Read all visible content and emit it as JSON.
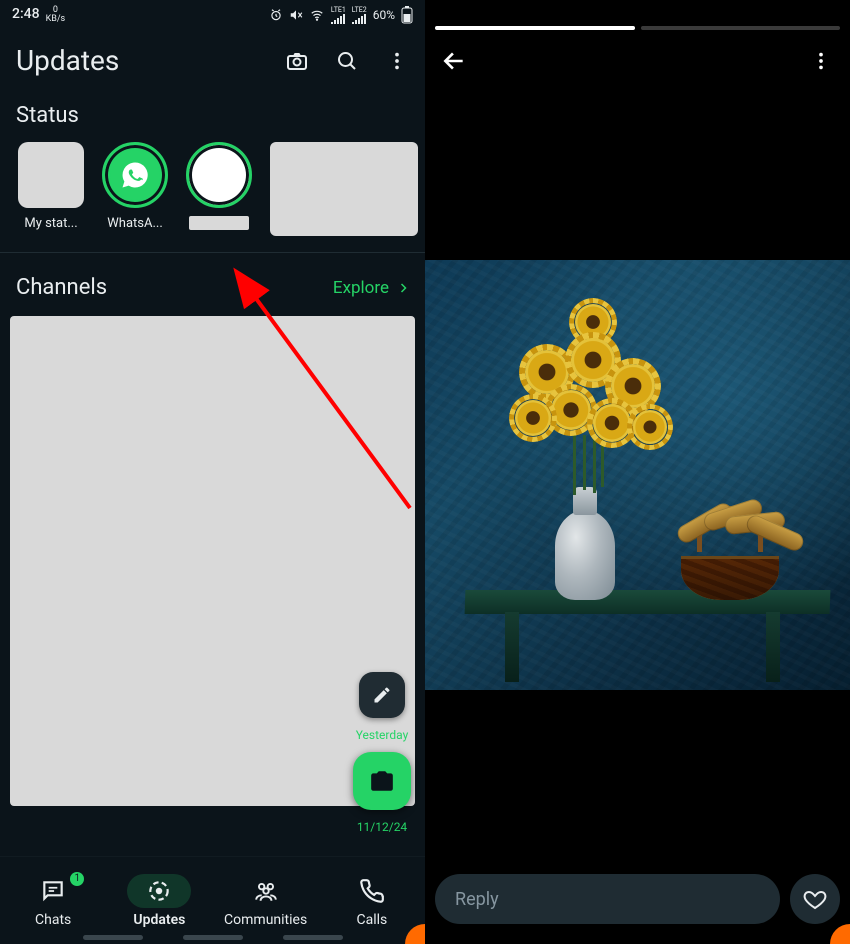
{
  "statusbar": {
    "time": "2:48",
    "net_speed_value": "0",
    "net_speed_unit": "KB/s",
    "battery": "60%",
    "lte1": "LTE1",
    "lte2": "LTE2"
  },
  "header": {
    "title": "Updates"
  },
  "status_section": {
    "title": "Status",
    "items": [
      {
        "label": "My stat..."
      },
      {
        "label": "WhatsA..."
      },
      {
        "label": ""
      }
    ]
  },
  "channels_section": {
    "title": "Channels",
    "explore_label": "Explore"
  },
  "fabs": {
    "date_top": "Yesterday",
    "date_bottom": "11/12/24"
  },
  "bottom_nav": {
    "chats": {
      "label": "Chats",
      "badge": "1"
    },
    "updates": {
      "label": "Updates"
    },
    "communities": {
      "label": "Communities"
    },
    "calls": {
      "label": "Calls"
    }
  },
  "status_viewer": {
    "reply_placeholder": "Reply"
  }
}
